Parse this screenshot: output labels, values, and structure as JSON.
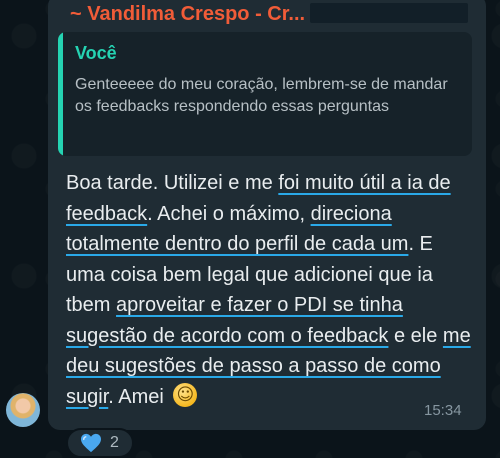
{
  "chat": {
    "sender_name": "~ Vandilma Crespo - Cr...",
    "quoted": {
      "author": "Você",
      "text": "Genteeeee do meu coração, lembrem-se de mandar os feedbacks respondendo essas perguntas"
    },
    "message": {
      "segments": [
        {
          "text": "Boa tarde. Utilizei e me ",
          "hl": false
        },
        {
          "text": "foi muito útil a ia de feedback",
          "hl": true
        },
        {
          "text": ".  Achei o máximo, ",
          "hl": false
        },
        {
          "text": "direciona totalmente dentro do perfil de cada um",
          "hl": true
        },
        {
          "text": ". E uma coisa bem legal que adicionei que ia tbem ",
          "hl": false
        },
        {
          "text": "aproveitar e fazer o PDI se tinha sugestão de acordo com o feedback",
          "hl": true
        },
        {
          "text": " e ele ",
          "hl": false
        },
        {
          "text": "me deu sugestões de passo a passo de como sugir",
          "hl": true
        },
        {
          "text": ". Amei ",
          "hl": false
        }
      ],
      "emoji": "smiling-face-emoji",
      "highlight_color": "#2aa9e8"
    },
    "timestamp": "15:34",
    "reaction": {
      "icon": "blue-heart-icon",
      "count": "2"
    }
  },
  "colors": {
    "background": "#0b141a",
    "bubble": "#1f2c34",
    "sender": "#f15c38",
    "quote_accent": "#25d3b2"
  }
}
